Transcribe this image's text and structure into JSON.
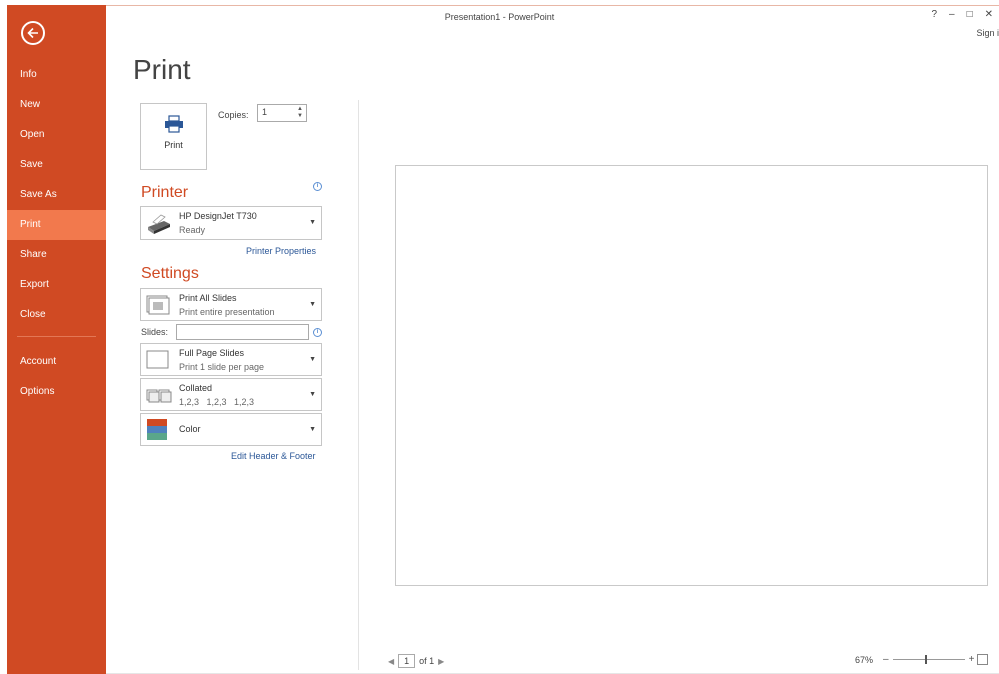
{
  "window": {
    "title": "Presentation1 - PowerPoint",
    "help": "?",
    "minimize": "–",
    "maximize": "□",
    "close": "✕",
    "signin": "Sign i"
  },
  "nav": {
    "back_icon": "back-arrow-icon",
    "items": [
      {
        "label": "Info"
      },
      {
        "label": "New"
      },
      {
        "label": "Open"
      },
      {
        "label": "Save"
      },
      {
        "label": "Save As"
      },
      {
        "label": "Print",
        "active": true
      },
      {
        "label": "Share"
      },
      {
        "label": "Export"
      },
      {
        "label": "Close"
      },
      {
        "label": "Account"
      },
      {
        "label": "Options"
      }
    ],
    "bg_color": "#d04a23",
    "active_color": "#f2794d"
  },
  "page": {
    "title": "Print",
    "print_button": "Print",
    "copies_label": "Copies:",
    "copies_value": "1"
  },
  "printer": {
    "section_title": "Printer",
    "name": "HP DesignJet T730",
    "status": "Ready",
    "properties_link": "Printer Properties"
  },
  "settings": {
    "section_title": "Settings",
    "range_main": "Print All Slides",
    "range_sub": "Print entire presentation",
    "slides_label": "Slides:",
    "slides_value": "",
    "layout_main": "Full Page Slides",
    "layout_sub": "Print 1 slide per page",
    "collate_main": "Collated",
    "collate_sub": "1,2,3   1,2,3   1,2,3",
    "color_main": "Color",
    "header_footer_link": "Edit Header & Footer"
  },
  "preview": {
    "page_current": "1",
    "page_total": "of 1",
    "zoom_level": "67%",
    "zoom_fraction": 0.45
  },
  "colors": {
    "accent": "#d04a23",
    "link": "#2b5797"
  }
}
